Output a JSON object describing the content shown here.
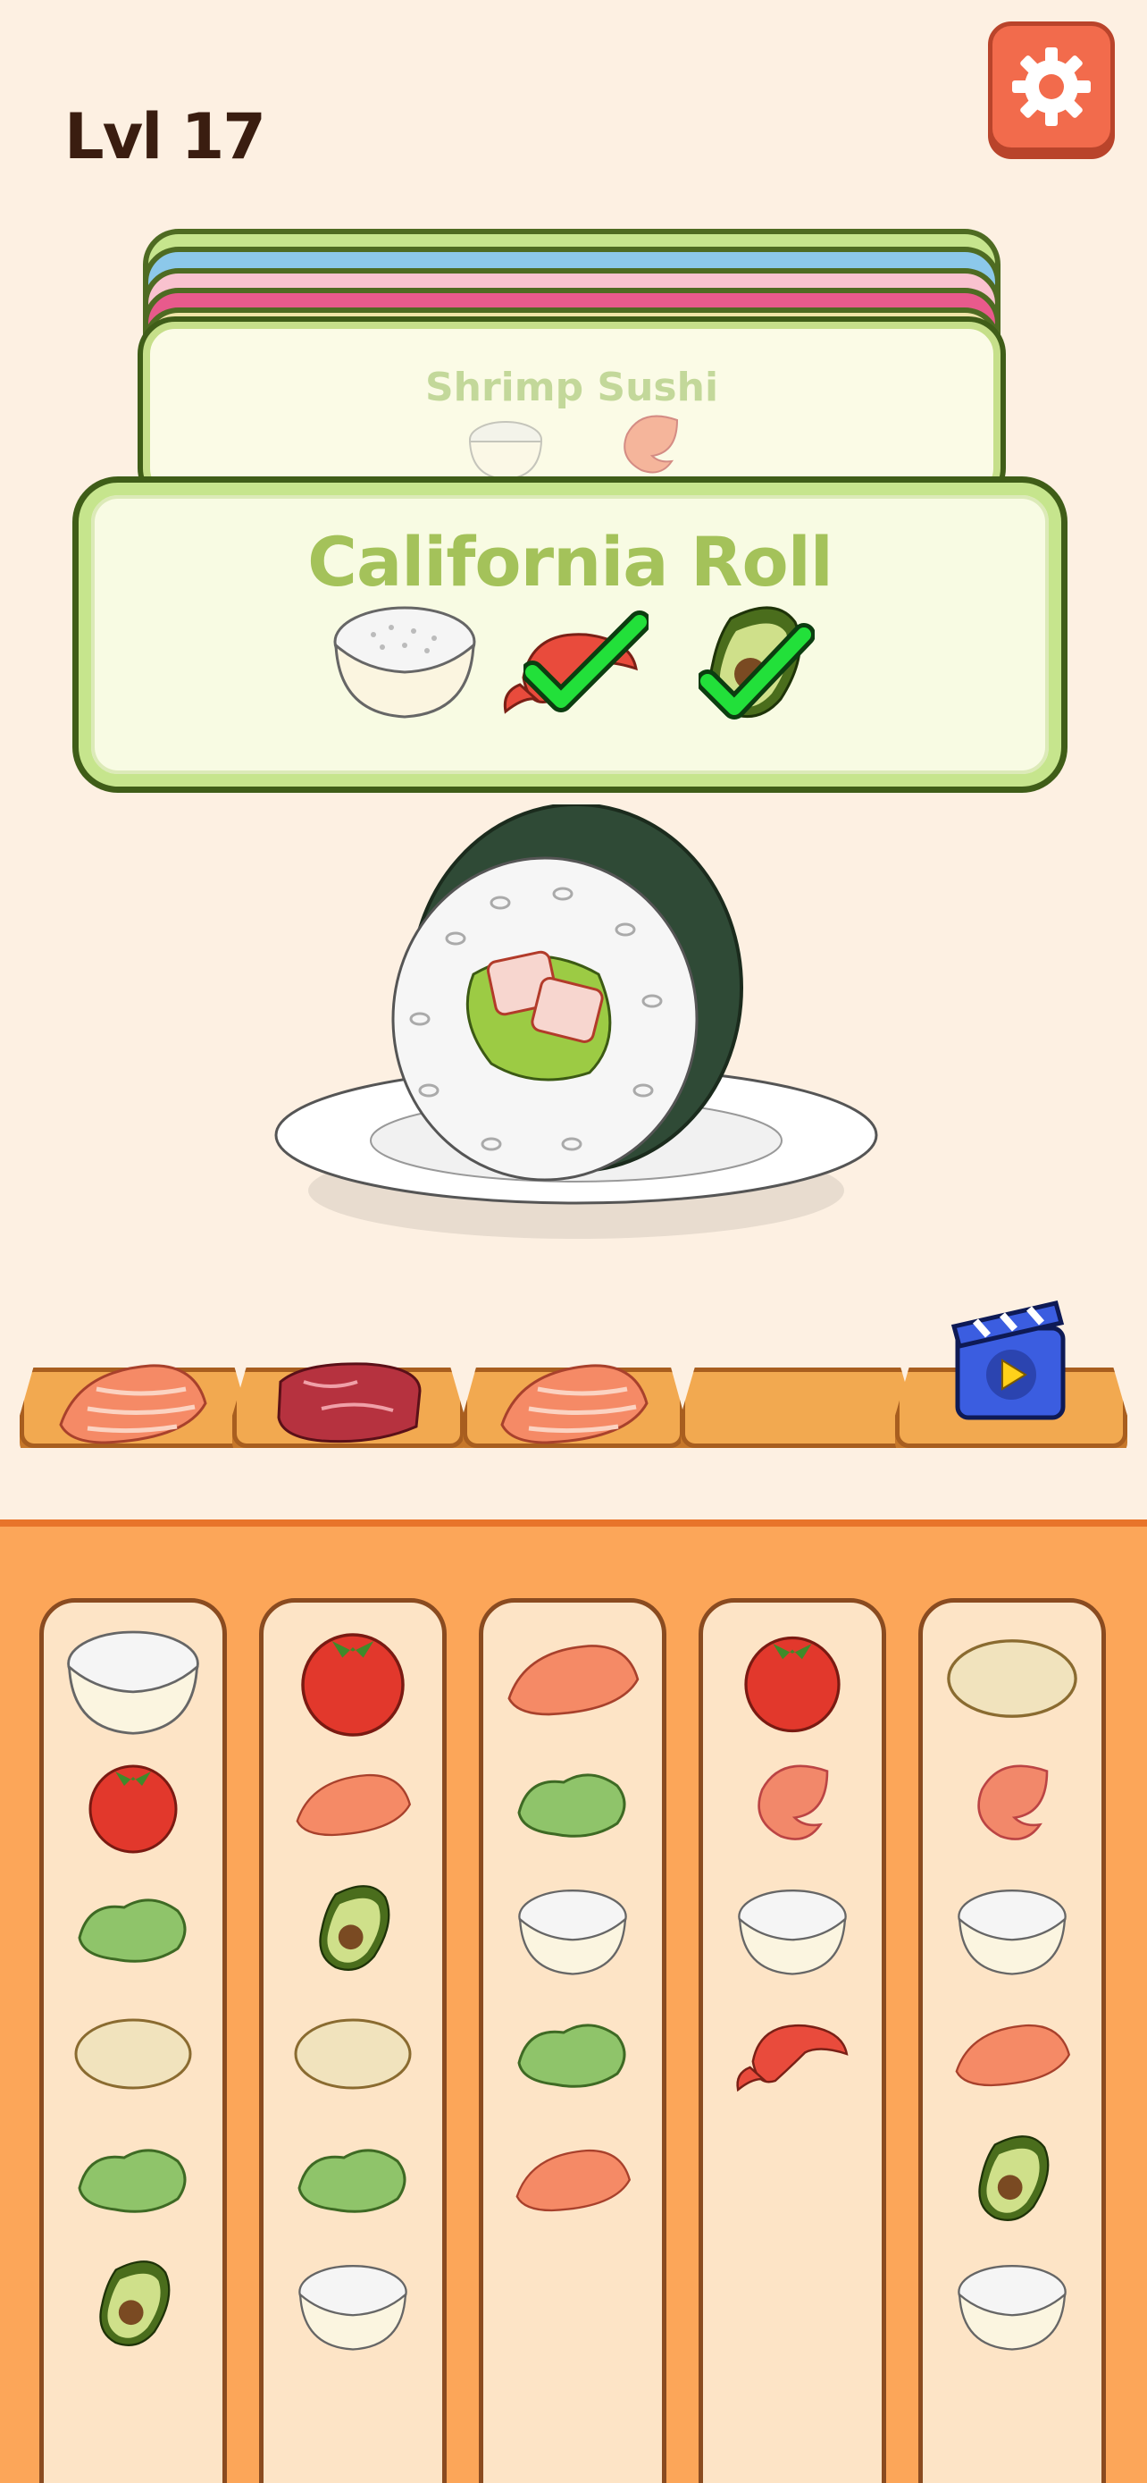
{
  "hud": {
    "level": "Lvl 17",
    "settings_icon": "gear-icon"
  },
  "orders": {
    "stack_colors": [
      "#c6e58d",
      "#8cc8ea",
      "#f59ab0",
      "#e85a8c",
      "#c6df8a"
    ],
    "next": {
      "title": "Shrimp Sushi",
      "ingredients": [
        "rice",
        "shrimp"
      ]
    },
    "current": {
      "title": "California Roll",
      "ingredients": [
        {
          "name": "rice",
          "done": false
        },
        {
          "name": "crab",
          "done": true
        },
        {
          "name": "avocado",
          "done": true
        }
      ]
    }
  },
  "dish": {
    "name": "california-roll-plate"
  },
  "shelf": {
    "slots": [
      "salmon",
      "beef",
      "salmon",
      "empty",
      "ad-video"
    ]
  },
  "columns": [
    [
      "rice",
      "tomato",
      "lettuce",
      "bun",
      "lettuce",
      "avocado"
    ],
    [
      "tomato",
      "salmon",
      "avocado",
      "bun",
      "lettuce",
      "rice"
    ],
    [
      "salmon",
      "lettuce",
      "rice",
      "lettuce",
      "salmon"
    ],
    [
      "tomato",
      "shrimp",
      "rice",
      "crab"
    ],
    [
      "bun",
      "shrimp",
      "rice",
      "salmon",
      "avocado",
      "rice"
    ]
  ],
  "colors": {
    "background": "#fdf0e2",
    "accent": "#f26b4c",
    "card_green": "#c6e58d",
    "check_green": "#22e03a"
  }
}
